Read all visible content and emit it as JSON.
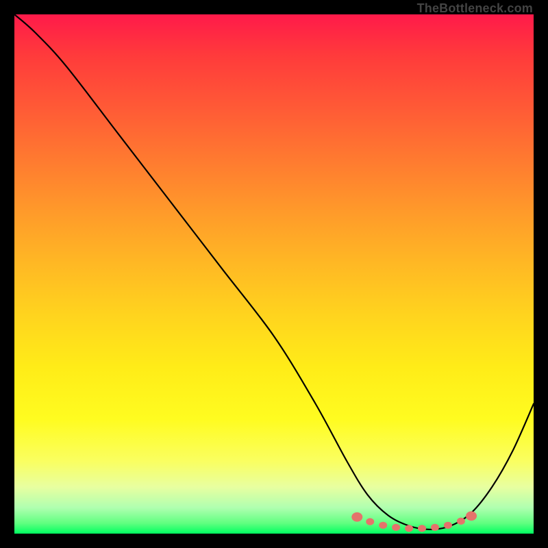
{
  "watermark": "TheBottleneck.com",
  "chart_data": {
    "type": "line",
    "title": "",
    "xlabel": "",
    "ylabel": "",
    "xlim": [
      0,
      100
    ],
    "ylim": [
      0,
      100
    ],
    "grid": false,
    "series": [
      {
        "name": "bottleneck-curve",
        "x": [
          0,
          4,
          10,
          20,
          30,
          40,
          50,
          58,
          64,
          68,
          72,
          76,
          80,
          84,
          88,
          92,
          96,
          100
        ],
        "y": [
          100,
          96.5,
          90,
          77,
          64,
          51,
          38,
          25,
          14,
          7.5,
          3.5,
          1.5,
          0.8,
          1.5,
          4,
          9,
          16,
          25
        ]
      }
    ],
    "markers": {
      "name": "optimal-range",
      "x": [
        66,
        68.5,
        71,
        73.5,
        76,
        78.5,
        81,
        83.5,
        86,
        88
      ],
      "y": [
        3.2,
        2.3,
        1.6,
        1.2,
        1.0,
        1.0,
        1.2,
        1.6,
        2.4,
        3.4
      ]
    },
    "background_gradient": {
      "top": "#ff1a4a",
      "bottom": "#00ff60"
    }
  }
}
